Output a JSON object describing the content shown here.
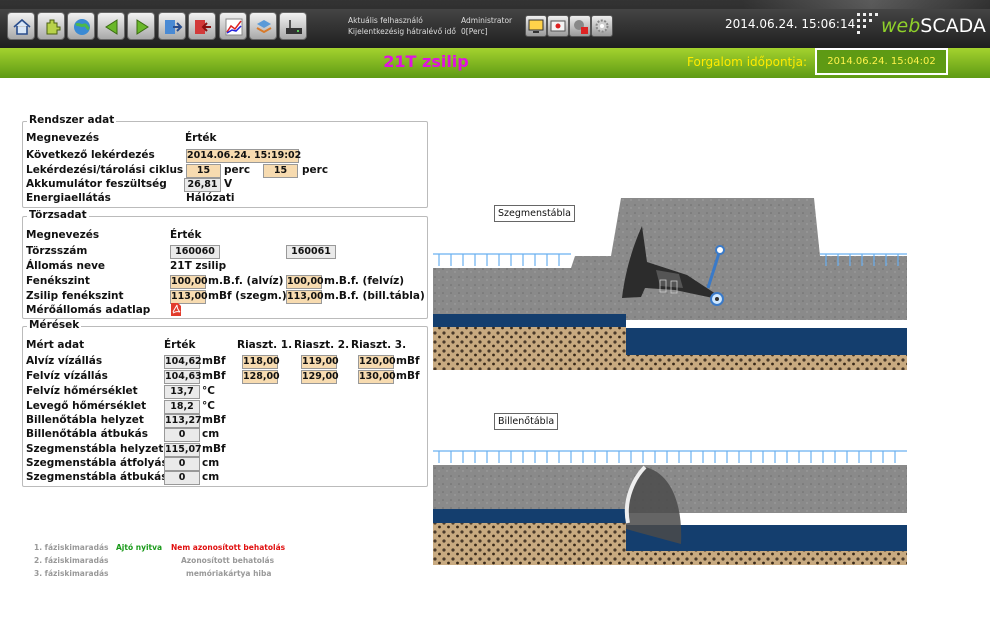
{
  "header": {
    "user_label": "Aktuális felhasználó",
    "user_value": "Administrator",
    "idle_label": "Kijelentkezésig hátralévő idő",
    "idle_value": "0[Perc]",
    "clock": "2014.06.24. 15:06:14",
    "logo_web": "web",
    "logo_scada": "SCADA"
  },
  "nav_icons": [
    "home-icon",
    "plugin-icon",
    "globe-icon",
    "back-arrow-icon",
    "forward-arrow-icon",
    "export-icon",
    "import-icon",
    "chart-icon",
    "layers-icon",
    "router-icon"
  ],
  "tool_icons": [
    "monitor-icon",
    "alarm-map-icon",
    "settings-cancel-icon",
    "gear-icon"
  ],
  "station": {
    "title": "21T zsilip",
    "traffic_label": "Forgalom időpontja:",
    "traffic_time": "2014.06.24. 15:04:02"
  },
  "system": {
    "header": "Rendszer adat",
    "name_col": "Megnevezés",
    "value_col": "Érték",
    "next_query_label": "Következő lekérdezés",
    "next_query_value": "2014.06.24. 15:19:02",
    "cycle_label": "Lekérdezési/tárolási ciklus",
    "cycle_query": "15",
    "cycle_store": "15",
    "unit_perc": "perc",
    "battery_label": "Akkumulátor feszültség",
    "battery_value": "26,81",
    "battery_unit": "V",
    "power_label": "Energiaellátás",
    "power_value": "Hálózati"
  },
  "master": {
    "header": "Törzsadat",
    "name_col": "Megnevezés",
    "value_col": "Érték",
    "serial_label": "Törzsszám",
    "serial_1": "160060",
    "serial_2": "160061",
    "station_label": "Állomás neve",
    "station_value": "21T zsilip",
    "floor_label": "Fenékszint",
    "floor_1": "100,00",
    "floor_1_unit": "m.B.f. (alvíz)",
    "floor_2": "100,00",
    "floor_2_unit": "m.B.f. (felvíz)",
    "gate_floor_label": "Zsilip fenékszint",
    "gate_floor_1": "113,00",
    "gate_floor_1_unit": "mBf (szegm.)",
    "gate_floor_2": "113,00",
    "gate_floor_2_unit": "m.B.f. (bill.tábla)",
    "datasheet_label": "Mérőállomás adatlap"
  },
  "measurements": {
    "header": "Mérések",
    "col_name": "Mért adat",
    "col_value": "Érték",
    "col_alarm1": "Riaszt. 1.",
    "col_alarm2": "Riaszt. 2.",
    "col_alarm3": "Riaszt. 3.",
    "rows": [
      {
        "label": "Alvíz vízállás",
        "value": "104,62",
        "unit": "mBf",
        "a1": "118,00",
        "a2": "119,00",
        "a3": "120,00",
        "a3unit": "mBf"
      },
      {
        "label": "Felvíz vízállás",
        "value": "104,63",
        "unit": "mBf",
        "a1": "128,00",
        "a2": "129,00",
        "a3": "130,00",
        "a3unit": "mBf"
      },
      {
        "label": "Felvíz hőmérséklet",
        "value": "13,7",
        "unit": "°C"
      },
      {
        "label": "Levegő hőmérséklet",
        "value": "18,2",
        "unit": "°C"
      },
      {
        "label": "Billenőtábla helyzet",
        "value": "113,27",
        "unit": "mBf"
      },
      {
        "label": "Billenőtábla átbukás",
        "value": "0",
        "unit": "cm"
      },
      {
        "label": "Szegmenstábla helyzet",
        "value": "115,07",
        "unit": "mBf"
      },
      {
        "label": "Szegmenstábla átfolyás",
        "value": "0",
        "unit": "cm"
      },
      {
        "label": "Szegmenstábla átbukás",
        "value": "0",
        "unit": "cm"
      }
    ]
  },
  "phases": {
    "p1": "1. fáziskimaradás",
    "p2": "2. fáziskimaradás",
    "p3": "3. fáziskimaradás",
    "door": "Ajtó nyitva",
    "door_color": "#1a9a1a",
    "unauth": "Nem azonosított behatolás",
    "unauth_color": "#e01010",
    "auth": "Azonosított behatolás",
    "memory": "memóriakártya hiba",
    "inactive_color": "#999999"
  },
  "diagram": {
    "segment_label": "Szegmenstábla",
    "tilting_label": "Billenőtábla"
  },
  "colors": {
    "green_bar": "#7bb51f",
    "title": "#e012e0",
    "traffic_text": "#ffeb00",
    "water": "#143e6e"
  }
}
